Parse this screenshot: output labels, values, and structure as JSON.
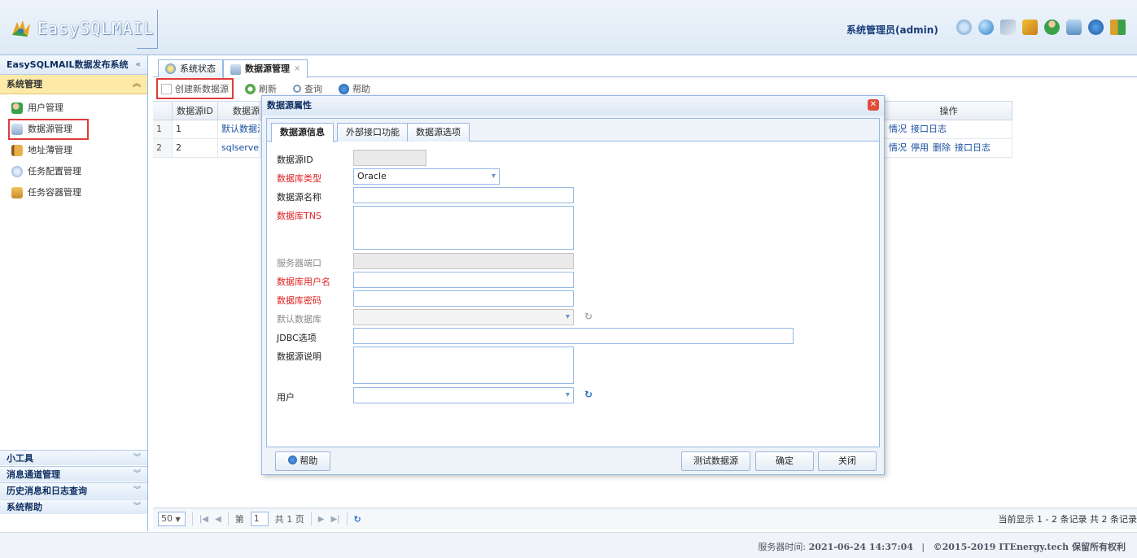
{
  "header": {
    "logo_text": "EasySQLMAIL",
    "user": "系统管理员(admin)",
    "icons": [
      "gear-icon",
      "globe-icon",
      "tools-icon",
      "brush-icon",
      "user-icon",
      "package-icon",
      "help-icon",
      "exit-icon"
    ]
  },
  "left": {
    "title": "EasySQLMAIL数据发布系统",
    "section": "系统管理",
    "items": [
      {
        "label": "用户管理",
        "icon": "users-icon"
      },
      {
        "label": "数据源管理",
        "icon": "datasource-icon"
      },
      {
        "label": "地址薄管理",
        "icon": "addressbook-icon"
      },
      {
        "label": "任务配置管理",
        "icon": "task-config-icon"
      },
      {
        "label": "任务容器管理",
        "icon": "task-container-icon"
      }
    ],
    "bottom": [
      "小工具",
      "消息通道管理",
      "历史消息和日志查询",
      "系统帮助"
    ]
  },
  "tabs": [
    {
      "label": "系统状态"
    },
    {
      "label": "数据源管理"
    }
  ],
  "toolbar": {
    "create": "创建新数据源",
    "refresh": "刷新",
    "query": "查询",
    "help": "帮助"
  },
  "grid": {
    "columns": [
      "数据源ID",
      "数据源",
      "操作"
    ],
    "rows": [
      {
        "n": "1",
        "id": "1",
        "name": "默认数据源",
        "ops": [
          "情况",
          "接口日志"
        ]
      },
      {
        "n": "2",
        "id": "2",
        "name": "sqlserver",
        "ops": [
          "情况",
          "停用",
          "删除",
          "接口日志"
        ]
      }
    ]
  },
  "pager": {
    "page_size": "50",
    "page_prefix": "第",
    "page": "1",
    "total_pages": "共 1 页",
    "info": "当前显示 1 - 2 条记录 共 2 条记录"
  },
  "footer": {
    "server_time_label": "服务器时间:",
    "server_time": "2021-06-24 14:37:04",
    "separator": "|",
    "copyright": "©2015-2019 ITEnergy.tech 保留所有权利"
  },
  "dialog": {
    "title": "数据源属性",
    "tabs": [
      "数据源信息",
      "外部接口功能",
      "数据源选项"
    ],
    "fields": {
      "id_label": "数据源ID",
      "id_value": "",
      "dbtype_label": "数据库类型",
      "dbtype_value": "Oracle",
      "name_label": "数据源名称",
      "name_value": "",
      "tns_label": "数据库TNS",
      "tns_value": "",
      "port_label": "服务器端口",
      "port_value": "",
      "dbuser_label": "数据库用户名",
      "dbuser_value": "",
      "dbpass_label": "数据库密码",
      "dbpass_value": "",
      "defaultdb_label": "默认数据库",
      "defaultdb_value": "",
      "jdbc_label": "JDBC选项",
      "jdbc_value": "",
      "desc_label": "数据源说明",
      "desc_value": "",
      "user_label": "用户",
      "user_value": ""
    },
    "buttons": {
      "help": "帮助",
      "test": "测试数据源",
      "ok": "确定",
      "close": "关闭"
    }
  }
}
